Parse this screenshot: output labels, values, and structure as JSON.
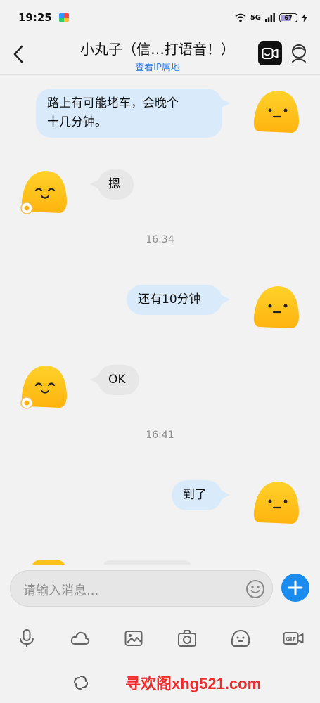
{
  "status_bar": {
    "time": "19:25",
    "network": "5G",
    "battery": "67"
  },
  "header": {
    "title": "小丸子（信…打语音！）",
    "subtitle": "查看IP属地"
  },
  "messages": [
    {
      "sender": "self",
      "text_lines": [
        "路上有可能堵车，会晚个",
        "十几分钟。"
      ]
    },
    {
      "sender": "other",
      "text": "摁"
    },
    {
      "sender": "system",
      "text": "16:34"
    },
    {
      "sender": "self",
      "text": "还有10分钟"
    },
    {
      "sender": "other",
      "text": "OK"
    },
    {
      "sender": "system",
      "text": "16:41"
    },
    {
      "sender": "self",
      "text": "到了"
    }
  ],
  "input": {
    "placeholder": "请输入消息..."
  },
  "toolbar": {
    "icons": [
      "microphone-icon",
      "cloud-icon",
      "image-icon",
      "camera-icon",
      "sticker-icon",
      "gif-icon"
    ]
  },
  "watermark": "寻欢阁xhg521.com",
  "colors": {
    "self_bubble": "#d9ebfb",
    "other_bubble": "#e7e7e7",
    "accent": "#1a8cf0",
    "avatar": "#ffc21a"
  }
}
